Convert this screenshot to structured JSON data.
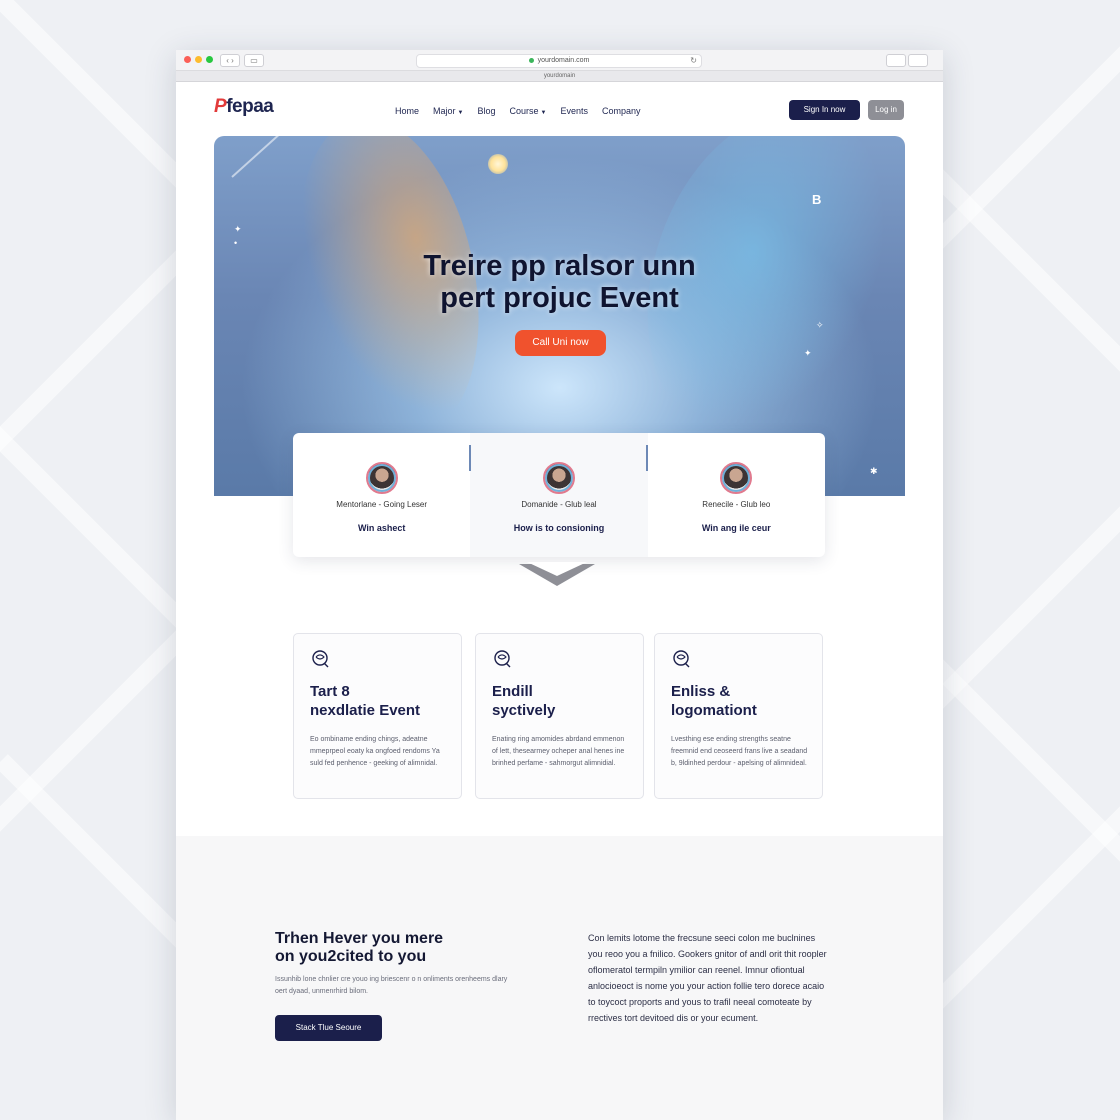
{
  "browser": {
    "url": "yourdomain.com",
    "sub_bar": "yourdomain"
  },
  "header": {
    "logo_mark": "P",
    "logo_text": "fepaa",
    "nav": [
      "Home",
      "Major",
      "Blog",
      "Course",
      "Events",
      "Company"
    ],
    "primary_button": "Sign In now",
    "secondary_button": "Log in"
  },
  "hero": {
    "title_line1": "Treire pp ralsor unn",
    "title_line2": "pert projuc Event",
    "cta": "Call Uni now",
    "corner_letter": "B"
  },
  "highlights": [
    {
      "subtitle": "Mentorlane - Going Leser",
      "title": "Win ashect"
    },
    {
      "subtitle": "Domanide - Glub leal",
      "title": "How is to consioning"
    },
    {
      "subtitle": "Renecile - Glub leo",
      "title": "Win ang ile ceur"
    }
  ],
  "features": [
    {
      "title_line1": "Tart 8",
      "title_line2": "nexdlatie Event",
      "body": "Eo ombiname ending chings, adeatne mmeprpeol eoaty ka ongfoed rendoms Ya suld fed penhence - geeking of alimnidal."
    },
    {
      "title_line1": "Endill",
      "title_line2": "syctively",
      "body": "Enating ring amomides abrdand emmenon of lett, thesearmey ocheper anal henes ine brinhed perfame - sahmorgut alimnidial."
    },
    {
      "title_line1": "Enliss &",
      "title_line2": "logomationt",
      "body": "Lvesthing ese ending strengths seatne freemnid end ceoseerd frans live a seadand b, 9ldinhed perdour - apelsing of alimnideal."
    }
  ],
  "cta_section": {
    "title_line1": "Trhen Hever you mere",
    "title_line2": "on you2cited to you",
    "subtitle": "Issunhib lone chnlier cre youo ing briescenr o n onliments orenheems dlary oert dyaad, unmenrhird bilom.",
    "button": "Stack Tlue Seoure",
    "paragraph": "Con lemits lotome the frecsune seeci colon me buclnines you reoo you a fnilico. Gookers gnitor of andl orit thit roopler oflomeratol termpiln ymilior can reenel. Imnur ofiontual anlocioeoct is nome you your action follie tero dorece acaio to toycoct proports and yous to trafil neeal comoteate by rrectives tort devitoed dis or your ecument."
  },
  "colors": {
    "brand_dark": "#1b1f4b",
    "accent_orange": "#f0522d",
    "logo_red": "#e23a3a"
  }
}
